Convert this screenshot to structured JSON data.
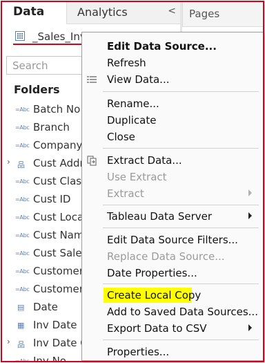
{
  "data_panel": {
    "tab_data": "Data",
    "tab_analytics": "Analytics",
    "collapse_glyph": "<",
    "data_source_name": "_Sales_Invoice",
    "search_placeholder": "Search",
    "folders_label": "Folders",
    "fields": [
      {
        "name": "Batch No",
        "type": "=Abc",
        "expandable": false
      },
      {
        "name": "Branch",
        "type": "=Abc",
        "expandable": false
      },
      {
        "name": "Company",
        "type": "=Abc",
        "expandable": false
      },
      {
        "name": "Cust Addr",
        "type": "hierarchy",
        "expandable": true
      },
      {
        "name": "Cust Class",
        "type": "=Abc",
        "expandable": false
      },
      {
        "name": "Cust ID",
        "type": "=Abc",
        "expandable": false
      },
      {
        "name": "Cust Locat",
        "type": "=Abc",
        "expandable": false
      },
      {
        "name": "Cust Name",
        "type": "=Abc",
        "expandable": false
      },
      {
        "name": "Cust Sales",
        "type": "=Abc",
        "expandable": false
      },
      {
        "name": "Customer",
        "type": "=Abc",
        "expandable": false
      },
      {
        "name": "Customer",
        "type": "=Abc",
        "expandable": false
      },
      {
        "name": "Date",
        "type": "date",
        "expandable": false
      },
      {
        "name": "Inv Date",
        "type": "date-calc",
        "expandable": false
      },
      {
        "name": "Inv Date O",
        "type": "hierarchy",
        "expandable": true
      },
      {
        "name": "Inv No",
        "type": "=Abc",
        "expandable": false
      }
    ]
  },
  "pages_panel": {
    "title": "Pages"
  },
  "context_menu": {
    "edit_data_source": "Edit Data Source...",
    "refresh": "Refresh",
    "view_data": "View Data...",
    "rename": "Rename...",
    "duplicate": "Duplicate",
    "close": "Close",
    "extract_data": "Extract Data...",
    "use_extract": "Use Extract",
    "extract": "Extract",
    "tableau_data_server": "Tableau Data Server",
    "edit_data_source_filters": "Edit Data Source Filters...",
    "replace_data_source": "Replace Data Source...",
    "date_properties": "Date Properties...",
    "create_local_copy": "Create Local Copy",
    "add_to_saved_data_sources": "Add to Saved Data Sources...",
    "export_data_to_csv": "Export Data to CSV",
    "properties": "Properties..."
  },
  "colors": {
    "highlight": "#ffff00",
    "annotation_red": "#d0021b",
    "field_icon_blue": "#5b7fb4"
  }
}
